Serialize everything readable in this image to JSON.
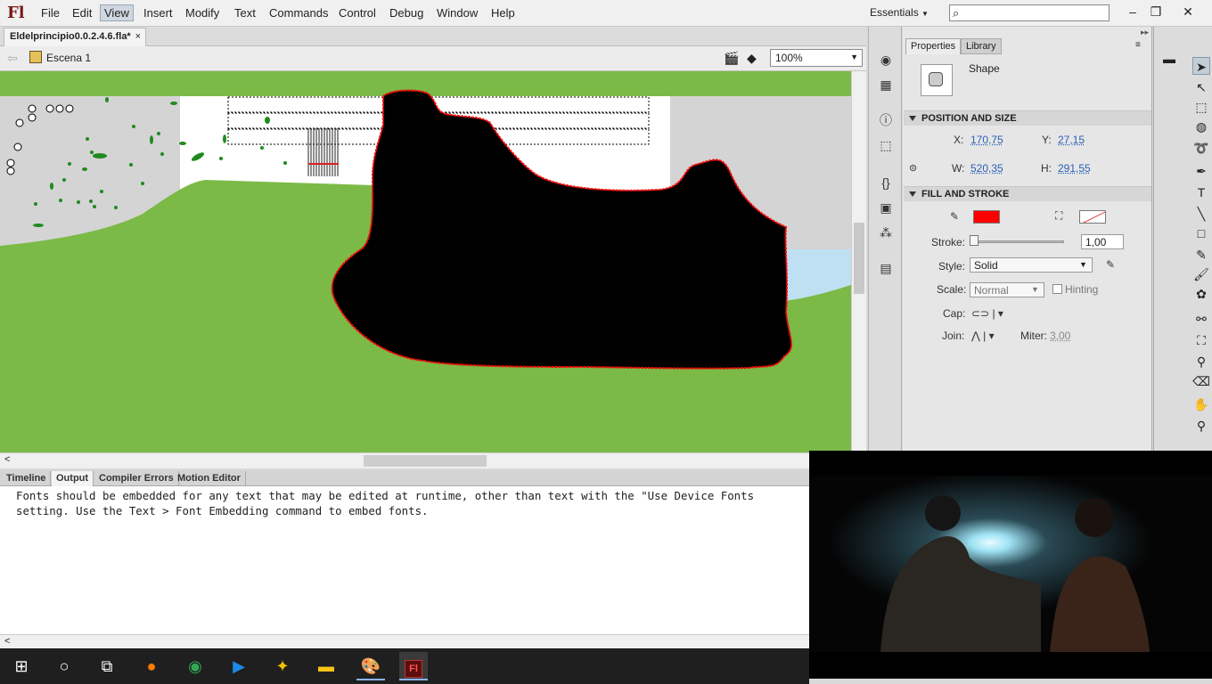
{
  "app": {
    "logo": "Fl"
  },
  "menu": [
    "File",
    "Edit",
    "View",
    "Insert",
    "Modify",
    "Text",
    "Commands",
    "Control",
    "Debug",
    "Window",
    "Help"
  ],
  "active_menu": "View",
  "workspace": {
    "label": "Essentials"
  },
  "document": {
    "tab_title": "Eldelprincipio0.0.2.4.6.fla*",
    "close": "×"
  },
  "scene": {
    "name": "Escena 1"
  },
  "zoom": {
    "value": "100%"
  },
  "bottom_panel": {
    "tabs": [
      "Timeline",
      "Output",
      "Compiler Errors",
      "Motion Editor"
    ],
    "selected": "Output",
    "output_lines": [
      "Fonts should be embedded for any text that may be edited at runtime, other than text with the \"Use Device Fonts",
      "setting. Use the Text > Font Embedding command to embed fonts."
    ]
  },
  "properties": {
    "tabs": [
      "Properties",
      "Library"
    ],
    "object_type": "Shape",
    "position_size": {
      "header": "POSITION AND SIZE",
      "x_label": "X:",
      "x": "170,75",
      "y_label": "Y:",
      "y": "27,15",
      "w_label": "W:",
      "w": "520,35",
      "h_label": "H:",
      "h": "291,55"
    },
    "fill_stroke": {
      "header": "FILL AND STROKE",
      "stroke_color": "#ff0000",
      "stroke_label": "Stroke:",
      "stroke_value": "1,00",
      "style_label": "Style:",
      "style": "Solid",
      "scale_label": "Scale:",
      "scale": "Normal",
      "hinting_label": "Hinting",
      "cap_label": "Cap:",
      "join_label": "Join:",
      "miter_label": "Miter:",
      "miter": "3,00"
    }
  },
  "colors": {
    "stage_green": "#7cba47",
    "shape_fill": "#000000",
    "shape_stroke": "#ff0000",
    "water": "#bfe0f2"
  }
}
